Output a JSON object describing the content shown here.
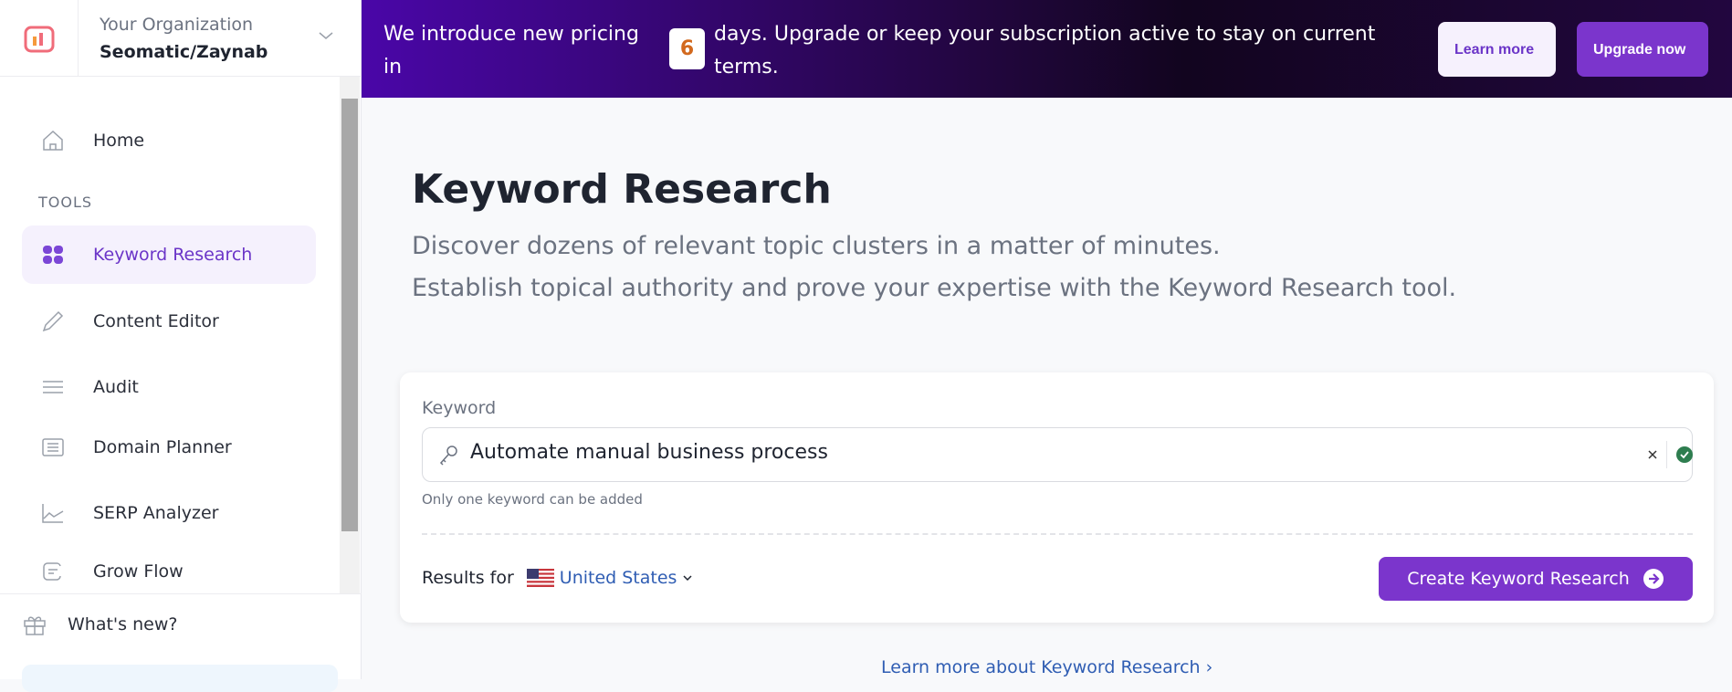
{
  "org": {
    "label": "Your Organization",
    "name": "Seomatic/Zaynab"
  },
  "sidebar": {
    "home": "Home",
    "section": "TOOLS",
    "items": [
      {
        "label": "Keyword Research",
        "icon": "grid-icon",
        "active": true
      },
      {
        "label": "Content Editor",
        "icon": "pencil-icon"
      },
      {
        "label": "Audit",
        "icon": "lines-icon"
      },
      {
        "label": "Domain Planner",
        "icon": "document-icon"
      },
      {
        "label": "SERP Analyzer",
        "icon": "chart-icon"
      },
      {
        "label": "Grow Flow",
        "icon": "flow-icon"
      }
    ],
    "whats_new": "What's new?"
  },
  "banner": {
    "text_before": "We introduce new pricing in",
    "days": "6",
    "text_after": "days. Upgrade or keep your subscription active to stay on current terms.",
    "learn_more": "Learn more",
    "upgrade": "Upgrade now"
  },
  "main": {
    "title": "Keyword Research",
    "subtitle1": "Discover dozens of relevant topic clusters in a matter of minutes.",
    "subtitle2": "Establish topical authority and prove your expertise with the Keyword Research tool.",
    "form": {
      "label": "Keyword",
      "value": "Automate manual business process",
      "helper": "Only one keyword can be added",
      "results_for": "Results for",
      "country": "United States",
      "submit": "Create Keyword Research"
    },
    "learn_link": "Learn more about Keyword Research"
  },
  "colors": {
    "accent": "#7b35cc",
    "link": "#2f5db3",
    "days": "#d2691e",
    "valid": "#2e7d4f"
  }
}
